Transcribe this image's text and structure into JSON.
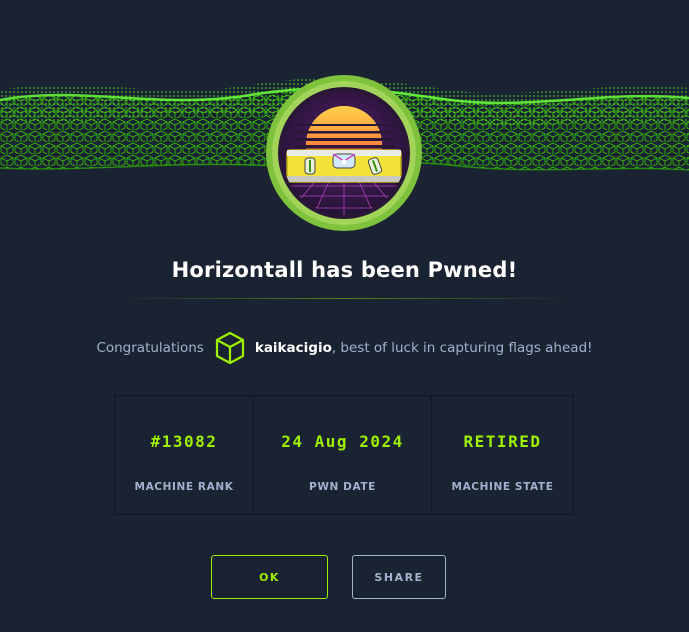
{
  "modal": {
    "title": "Horizontall has been Pwned!",
    "congrats_prefix": "Congratulations",
    "username": "kaikacigio",
    "congrats_suffix": ", best of luck in capturing flags ahead!",
    "stats": [
      {
        "value": "#13082",
        "label": "MACHINE RANK"
      },
      {
        "value": "24 Aug 2024",
        "label": "PWN DATE"
      },
      {
        "value": "RETIRED",
        "label": "MACHINE STATE"
      }
    ],
    "buttons": {
      "ok_label": "OK",
      "share_label": "SHARE"
    }
  },
  "icons": {
    "banner": "green-wireframe-wave",
    "avatar": "horizontall-machine-avatar",
    "user_badge": "green-cube-icon"
  },
  "colors": {
    "background": "#1a2332",
    "accent": "#9fef00",
    "muted_text": "#a4b1cd",
    "avatar_ring": "#7fc33c"
  }
}
